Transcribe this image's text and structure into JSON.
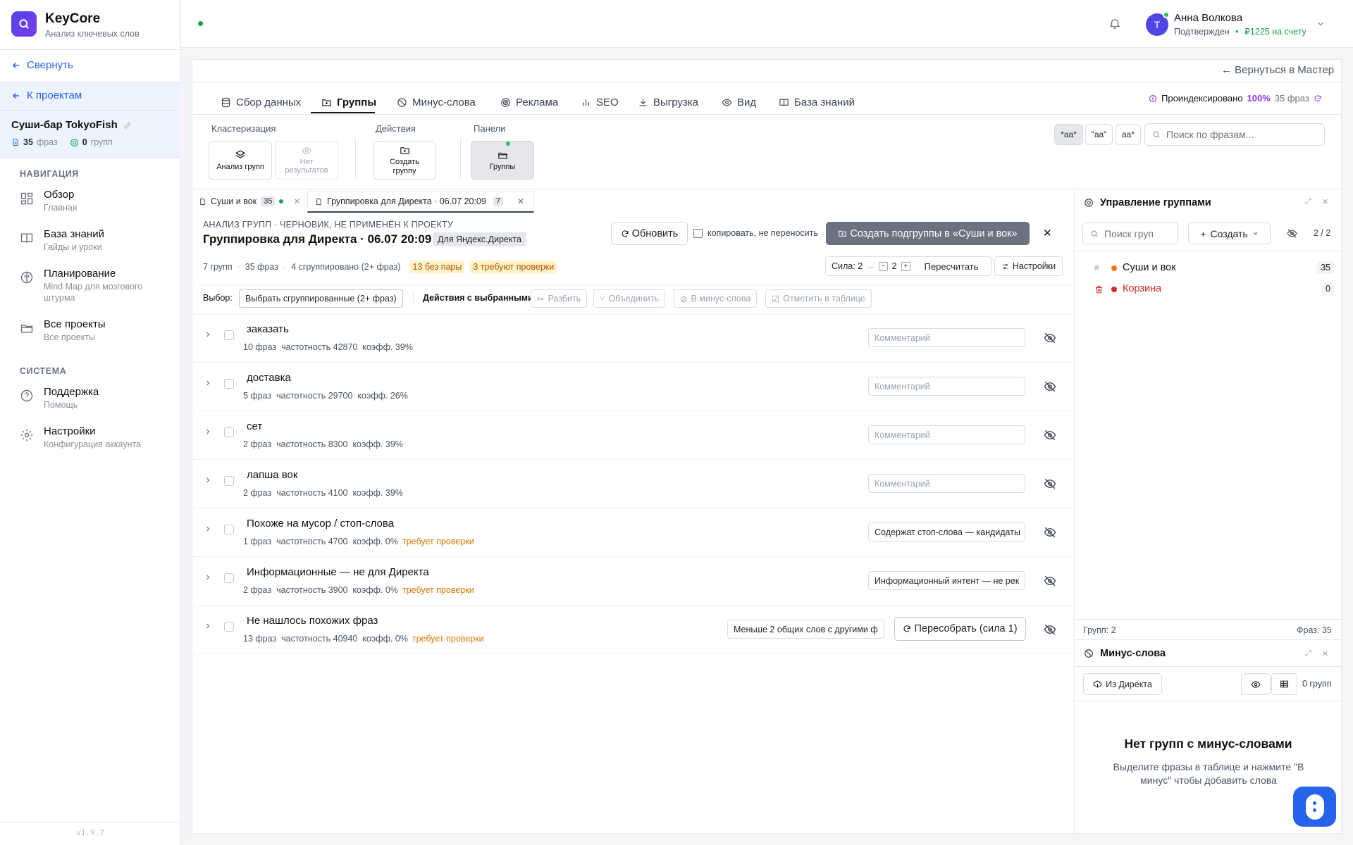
{
  "brand": {
    "title": "KeyCore",
    "subtitle": "Анализ ключевых слов"
  },
  "sidebar": {
    "collapse_label": "Свернуть",
    "projects_label": "К проектам",
    "project": {
      "name": "Суши-бар TokyoFish",
      "phrases_count": "35",
      "phrases_label": "фраз",
      "groups_count": "0",
      "groups_label": "групп"
    },
    "nav_heading": "НАВИГАЦИЯ",
    "nav": [
      {
        "label": "Обзор",
        "sub": "Главная"
      },
      {
        "label": "База знаний",
        "sub": "Гайды и уроки"
      },
      {
        "label": "Планирование",
        "sub": "Mind Map для мозгового штурма"
      },
      {
        "label": "Все проекты",
        "sub": "Все проекты"
      }
    ],
    "system_heading": "СИСТЕМА",
    "system": [
      {
        "label": "Поддержка",
        "sub": "Помощь"
      },
      {
        "label": "Настройки",
        "sub": "Конфигурация аккаунта"
      }
    ],
    "version": "v1.9.7"
  },
  "user": {
    "avatar_letter": "Т",
    "name": "Анна Волкова",
    "status": "Подтвержден",
    "balance": "₽1225 на счету"
  },
  "main": {
    "back_to_master": "← Вернуться в Мастер",
    "tabs": [
      "Сбор данных",
      "Группы",
      "Минус-слова",
      "Реклама",
      "SEO",
      "Выгрузка",
      "Вид",
      "База знаний"
    ],
    "index_status": {
      "label": "Проиндексировано",
      "percent": "100%",
      "phrases": "35 фраз"
    },
    "toolbar": {
      "cluster_heading": "Кластеризация",
      "actions_heading": "Действия",
      "panels_heading": "Панели",
      "analyze_label": "Анализ групп",
      "no_results_label": "Нет результатов",
      "create_group_label": "Создать группу",
      "groups_panel_label": "Группы"
    },
    "match_buttons": [
      "*aa*",
      "\"aa\"",
      "aa*"
    ],
    "search_placeholder": "Поиск по фразам..."
  },
  "doc_tabs": [
    {
      "label": "Суши и вок",
      "count": "35"
    },
    {
      "label": "Группировка для Директа · 06.07 20:09",
      "count": "7"
    }
  ],
  "analysis": {
    "kicker": "АНАЛИЗ ГРУПП · ЧЕРНОВИК, НЕ ПРИМЕНЁН К ПРОЕКТУ",
    "title": "Группировка для Директа · 06.07 20:09",
    "badge": "Для Яндекс.Директа",
    "refresh_label": "Обновить",
    "copy_label": "копировать, не переносить",
    "create_sub_label": "Создать подгруппы в «Суши и вок»",
    "stats": {
      "groups": "7 групп",
      "phrases": "35 фраз",
      "grouped": "4 сгруппировано (2+ фраз)",
      "no_pair": "13 без пары",
      "need_check": "3 требуют проверки"
    },
    "strength_label": "Сила: 2",
    "strength_value": "2",
    "recalc_label": "Пересчитать",
    "settings_label": "Настройки",
    "select_label": "Выбор:",
    "select_grouped_label": "Выбрать сгруппированные (2+ фраз)",
    "actions_label": "Действия с выбранными:",
    "action_buttons": [
      "Разбить",
      "Объединить",
      "В минус-слова",
      "Отметить в таблице"
    ],
    "comment_placeholder": "Комментарий",
    "rows": [
      {
        "name": "заказать",
        "phrases": "10 фраз",
        "freq": "частотность 42870",
        "coef": "коэфф. 39%",
        "warn": "",
        "comment": ""
      },
      {
        "name": "доставка",
        "phrases": "5 фраз",
        "freq": "частотность 29700",
        "coef": "коэфф. 26%",
        "warn": "",
        "comment": ""
      },
      {
        "name": "сет",
        "phrases": "2 фраз",
        "freq": "частотность 8300",
        "coef": "коэфф. 39%",
        "warn": "",
        "comment": ""
      },
      {
        "name": "лапша вок",
        "phrases": "2 фраз",
        "freq": "частотность 4100",
        "coef": "коэфф. 39%",
        "warn": "",
        "comment": ""
      },
      {
        "name": "Похоже на мусор / стоп-слова",
        "phrases": "1 фраз",
        "freq": "частотность 4700",
        "coef": "коэфф. 0%",
        "warn": "требует проверки",
        "comment": "Содержат стоп-слова — кандидаты"
      },
      {
        "name": "Информационные — не для Директа",
        "phrases": "2 фраз",
        "freq": "частотность 3900",
        "coef": "коэфф. 0%",
        "warn": "требует проверки",
        "comment": "Информационный интент — не рек"
      },
      {
        "name": "Не нашлось похожих фраз",
        "phrases": "13 фраз",
        "freq": "частотность 40940",
        "coef": "коэфф. 0%",
        "warn": "требует проверки",
        "comment": "Меньше 2 общих слов с другими ф",
        "action": "Пересобрать (сила 1)"
      }
    ]
  },
  "groups_panel": {
    "title": "Управление группами",
    "search_placeholder": "Поиск груп",
    "create_label": "Создать",
    "pager": "2 / 2",
    "items": [
      {
        "name": "Суши и вок",
        "count": "35",
        "color": "#f97316"
      },
      {
        "name": "Корзина",
        "count": "0",
        "color": "#dc2626"
      }
    ],
    "footer_groups": "Групп: 2",
    "footer_phrases": "Фраз: 35"
  },
  "minus_panel": {
    "title": "Минус-слова",
    "from_direct_label": "Из Директа",
    "groups_count": "0 групп",
    "empty_title": "Нет групп с минус-словами",
    "empty_text": "Выделите фразы в таблице и нажмите \"В минус\" чтобы добавить слова"
  },
  "colors": {
    "accent": "#4f46e5",
    "link": "#2563eb",
    "warn": "#d97706",
    "success": "#16a34a",
    "purple": "#9333ea"
  }
}
